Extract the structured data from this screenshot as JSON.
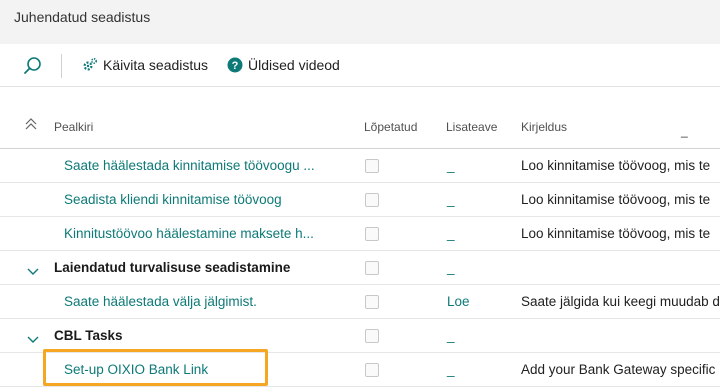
{
  "window": {
    "title": "Juhendatud seadistus"
  },
  "toolbar": {
    "search_icon": "search-icon",
    "run_setup_label": "Käivita seadistus",
    "videos_label": "Üldised videod",
    "accent_color": "#0d7a78"
  },
  "table": {
    "columns": {
      "title": "Pealkiri",
      "completed": "Lõpetatud",
      "more_info": "Lisateave",
      "description": "Kirjeldus"
    },
    "rows": [
      {
        "type": "item",
        "title": "Saate häälestada kinnitamise töövoogu ...",
        "completed": false,
        "more_info": "_",
        "description": "Loo kinnitamise töövoog, mis te"
      },
      {
        "type": "item",
        "title": "Seadista kliendi kinnitamise töövoog",
        "completed": false,
        "more_info": "_",
        "description": "Loo kinnitamise töövoog, mis te"
      },
      {
        "type": "item",
        "title": "Kinnitustöövoo häälestamine maksete h...",
        "completed": false,
        "more_info": "_",
        "description": "Loo kinnitamise töövoog, mis te"
      },
      {
        "type": "group",
        "title": "Laiendatud turvalisuse seadistamine",
        "completed": false,
        "more_info": "_",
        "description": ""
      },
      {
        "type": "item",
        "title": "Saate häälestada välja jälgimist.",
        "completed": false,
        "more_info": "Loe",
        "description": "Saate jälgida kui keegi muudab d"
      },
      {
        "type": "group",
        "title": "CBL Tasks",
        "completed": false,
        "more_info": "_",
        "description": ""
      },
      {
        "type": "item",
        "title": "Set-up OIXIO Bank Link",
        "completed": false,
        "more_info": "_",
        "description": "Add your Bank Gateway specific",
        "highlighted": true,
        "highlight_color": "#f5a623"
      }
    ]
  }
}
